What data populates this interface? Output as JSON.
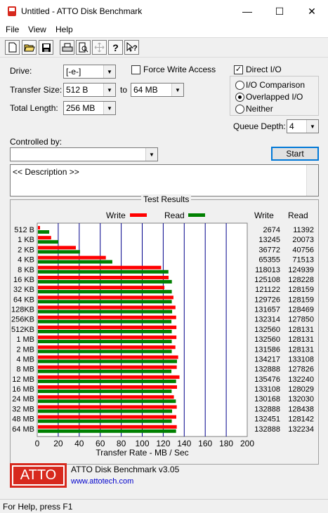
{
  "window": {
    "title": "Untitled - ATTO Disk Benchmark",
    "minimize": "—",
    "maximize": "☐",
    "close": "✕"
  },
  "menu": [
    "File",
    "View",
    "Help"
  ],
  "toolbar": {
    "buttons": [
      "new-icon",
      "open-icon",
      "save-icon",
      "print-icon",
      "print-preview-icon",
      "move-icon",
      "help-icon",
      "context-help-icon"
    ]
  },
  "settings": {
    "drive_label": "Drive:",
    "drive_value": "[-e-]",
    "transfer_size_label": "Transfer Size:",
    "transfer_from": "512 B",
    "to_label": "to",
    "transfer_to": "64 MB",
    "total_length_label": "Total Length:",
    "total_length": "256 MB",
    "force_write_access": "Force Write Access",
    "force_write_checked": false,
    "direct_io": "Direct I/O",
    "direct_io_checked": true,
    "io_comparison": "I/O Comparison",
    "overlapped_io": "Overlapped I/O",
    "neither": "Neither",
    "selected_mode": "Overlapped I/O",
    "queue_depth_label": "Queue Depth:",
    "queue_depth": "4",
    "controlled_by_label": "Controlled by:",
    "controlled_by_value": "",
    "start_label": "Start",
    "description": "<< Description >>"
  },
  "results": {
    "title": "Test Results",
    "legend_write": "Write",
    "legend_read": "Read",
    "col_write": "Write",
    "col_read": "Read",
    "xlabel": "Transfer Rate - MB / Sec",
    "write_color": "#ff0000",
    "read_color": "#008000",
    "grid_color": "#00008b"
  },
  "chart_data": {
    "type": "bar",
    "orientation": "horizontal",
    "title": "Test Results",
    "xlabel": "Transfer Rate - MB / Sec",
    "xlim": [
      0,
      200
    ],
    "xticks": [
      0,
      20,
      40,
      60,
      80,
      100,
      120,
      140,
      160,
      180,
      200
    ],
    "categories": [
      "512 B",
      "1 KB",
      "2 KB",
      "4 KB",
      "8 KB",
      "16 KB",
      "32 KB",
      "64 KB",
      "128KB",
      "256KB",
      "512KB",
      "1 MB",
      "2 MB",
      "4 MB",
      "8 MB",
      "12 MB",
      "16 MB",
      "24 MB",
      "32 MB",
      "48 MB",
      "64 MB"
    ],
    "series": [
      {
        "name": "Write",
        "values": [
          2674,
          13245,
          36772,
          65355,
          118013,
          125108,
          121122,
          129726,
          131657,
          132314,
          132560,
          132560,
          131586,
          134217,
          132888,
          135476,
          133108,
          130168,
          132888,
          132451,
          132888
        ]
      },
      {
        "name": "Read",
        "values": [
          11392,
          20073,
          40756,
          71513,
          124939,
          128228,
          128159,
          128159,
          128469,
          127850,
          128131,
          128131,
          128131,
          133108,
          127826,
          132240,
          128029,
          132030,
          128438,
          128142,
          132234
        ]
      }
    ],
    "grid": true,
    "legend": "top"
  },
  "footer": {
    "logo": "ATTO",
    "version": "ATTO Disk Benchmark v3.05",
    "website": "www.attotech.com"
  },
  "status": "For Help, press F1"
}
